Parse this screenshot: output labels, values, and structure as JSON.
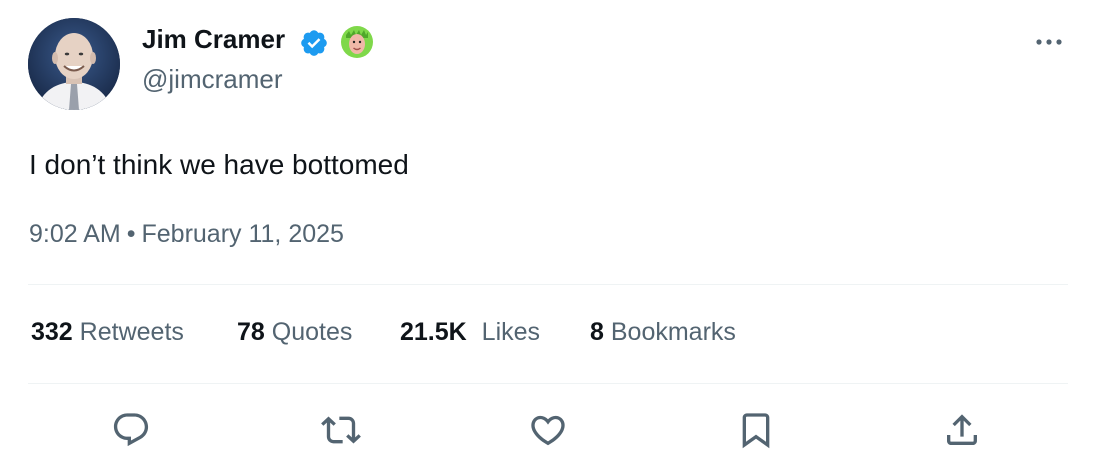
{
  "author": {
    "display_name": "Jim Cramer",
    "handle": "@jimcramer",
    "verified_icon": "verified-badge-icon",
    "extra_badge_icon": "green-avatar-emoji-icon"
  },
  "tweet": {
    "text": "I don’t think we have bottomed",
    "time": "9:02 AM",
    "separator": "•",
    "date": "February 11, 2025"
  },
  "stats": [
    {
      "number": "332",
      "label": "Retweets"
    },
    {
      "number": "78",
      "label": "Quotes"
    },
    {
      "number": "21.5K",
      "label": "Likes"
    },
    {
      "number": "8",
      "label": "Bookmarks"
    }
  ],
  "actions": [
    "reply-icon",
    "retweet-icon",
    "like-icon",
    "bookmark-icon",
    "share-icon"
  ],
  "colors": {
    "text_primary": "#0f1419",
    "text_secondary": "#536471",
    "divider": "#eff3f4",
    "verified_blue": "#1d9bf0"
  }
}
